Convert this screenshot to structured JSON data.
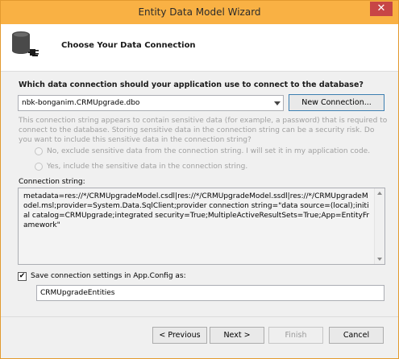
{
  "window": {
    "title": "Entity Data Model Wizard",
    "close_glyph": "✕"
  },
  "header": {
    "title": "Choose Your Data Connection"
  },
  "question": "Which data connection should your application use to connect to the database?",
  "connection": {
    "selected": "nbk-bonganim.CRMUpgrade.dbo",
    "new_button": "New Connection..."
  },
  "warning_text": "This connection string appears to contain sensitive data (for example, a password) that is required to connect to the database. Storing sensitive data in the connection string can be a security risk. Do you want to include this sensitive data in the connection string?",
  "options": {
    "exclude": "No, exclude sensitive data from the connection string. I will set it in my application code.",
    "include": "Yes, include the sensitive data in the connection string."
  },
  "connection_string": {
    "label": "Connection string:",
    "value": "metadata=res://*/CRMUpgradeModel.csdl|res://*/CRMUpgradeModel.ssdl|res://*/CRMUpgradeModel.msl;provider=System.Data.SqlClient;provider connection string=\"data source=(local);initial catalog=CRMUpgrade;integrated security=True;MultipleActiveResultSets=True;App=EntityFramework\""
  },
  "save_settings": {
    "label": "Save connection settings in App.Config as:",
    "checked": true,
    "check_glyph": "✔",
    "name": "CRMUpgradeEntities"
  },
  "buttons": {
    "previous": "< Previous",
    "next": "Next >",
    "finish": "Finish",
    "cancel": "Cancel"
  },
  "colors": {
    "titlebar": "#f9b144",
    "close": "#c74646",
    "disabled_text": "#a0a0a0"
  },
  "icons": {
    "header": "database-plug-icon",
    "dropdown": "chevron-down-icon"
  }
}
